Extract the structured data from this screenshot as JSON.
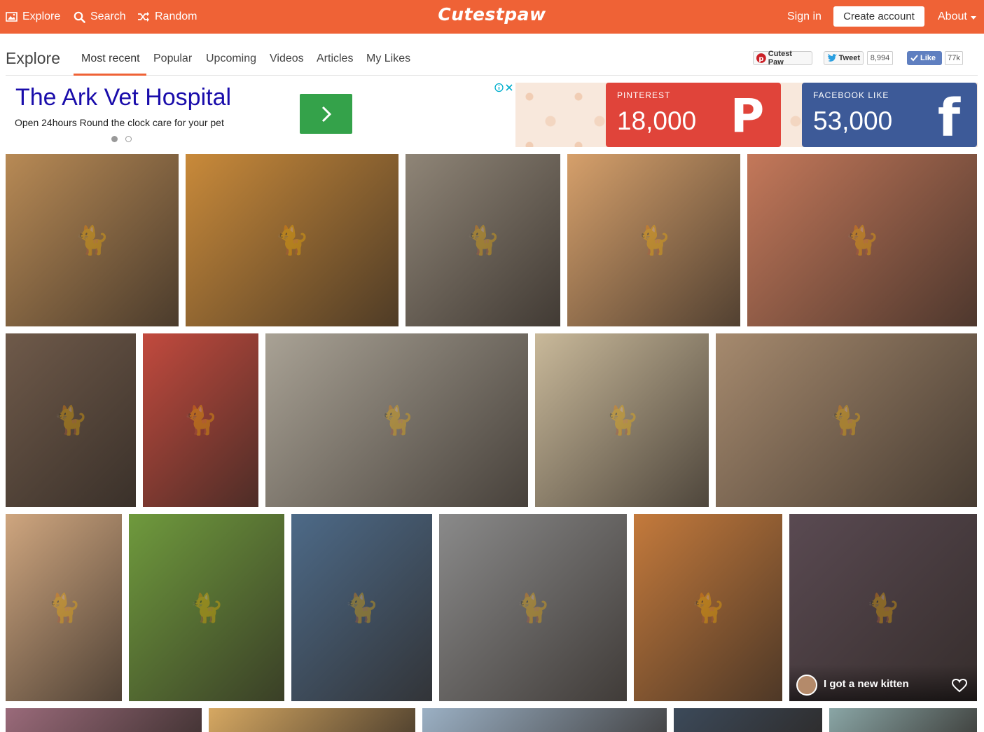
{
  "topbar": {
    "explore": "Explore",
    "search": "Search",
    "random": "Random",
    "logo": "Cutestpaw",
    "sign_in": "Sign in",
    "create_account": "Create account",
    "about": "About",
    "color": "#ef6236"
  },
  "subnav": {
    "title": "Explore",
    "tabs": [
      "Most recent",
      "Popular",
      "Upcoming",
      "Videos",
      "Articles",
      "My Likes"
    ],
    "active_tab": "Most recent",
    "pinterest_button": "Cutest Paw",
    "tweet_button": "Tweet",
    "tweet_count": "8,994",
    "like_button": "Like",
    "like_count": "77k"
  },
  "ad": {
    "title": "The Ark Vet Hospital",
    "description": "Open 24hours Round the clock care for your pet",
    "button_icon": "chevron-right-icon"
  },
  "stats": {
    "pinterest": {
      "label": "PINTEREST",
      "value": "18,000",
      "color": "#e0443a"
    },
    "facebook": {
      "label": "FACEBOOK LIKE",
      "value": "53,000",
      "color": "#3d5a98"
    }
  },
  "grid": {
    "caption": "I got a new kitten",
    "photo_colors": [
      "#b88a55",
      "#c98a3a",
      "#8f8577",
      "#d6a06b",
      "#c4785a",
      "#6f5a4a",
      "#c24a3e",
      "#a9a295",
      "#c9b99a",
      "#a68a6e",
      "#cfa67f",
      "#6f9a3d",
      "#4d6a88",
      "#8a8a8a",
      "#c47a3c",
      "#5a4a52",
      "#9a6a7a",
      "#d6a862",
      "#9bb0c4",
      "#3c4a5a",
      "#8aa6a6"
    ]
  }
}
